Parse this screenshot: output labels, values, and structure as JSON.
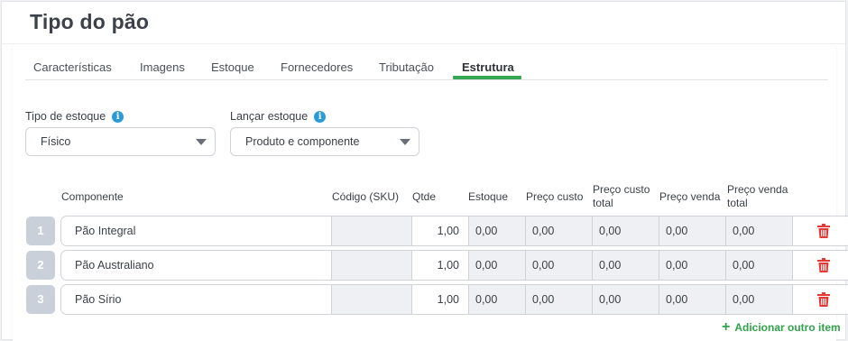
{
  "page": {
    "title": "Tipo do pão"
  },
  "tabs": [
    {
      "label": "Características"
    },
    {
      "label": "Imagens"
    },
    {
      "label": "Estoque"
    },
    {
      "label": "Fornecedores"
    },
    {
      "label": "Tributação"
    },
    {
      "label": "Estrutura",
      "active": true
    }
  ],
  "form": {
    "tipo_estoque": {
      "label": "Tipo de estoque",
      "value": "Físico"
    },
    "lancar_estoque": {
      "label": "Lançar estoque",
      "value": "Produto e componente"
    }
  },
  "table": {
    "headers": {
      "componente": "Componente",
      "sku": "Código (SKU)",
      "qtde": "Qtde",
      "estoque": "Estoque",
      "preco_custo": "Preço custo",
      "preco_custo_total": "Preço custo total",
      "preco_venda": "Preço venda",
      "preco_venda_total": "Preço venda total"
    },
    "rows": [
      {
        "num": "1",
        "componente": "Pão Integral",
        "sku": "",
        "qtde": "1,00",
        "estoque": "0,00",
        "preco_custo": "0,00",
        "preco_custo_total": "0,00",
        "preco_venda": "0,00",
        "preco_venda_total": "0,00"
      },
      {
        "num": "2",
        "componente": "Pão Australiano",
        "sku": "",
        "qtde": "1,00",
        "estoque": "0,00",
        "preco_custo": "0,00",
        "preco_custo_total": "0,00",
        "preco_venda": "0,00",
        "preco_venda_total": "0,00"
      },
      {
        "num": "3",
        "componente": "Pão Sírio",
        "sku": "",
        "qtde": "1,00",
        "estoque": "0,00",
        "preco_custo": "0,00",
        "preco_custo_total": "0,00",
        "preco_venda": "0,00",
        "preco_venda_total": "0,00"
      }
    ]
  },
  "actions": {
    "add_item": "Adicionar outro item"
  },
  "icons": {
    "info": "info-icon",
    "trash": "trash-icon",
    "caret": "chevron-down-icon",
    "plus": "plus-icon"
  },
  "colors": {
    "accent": "#34a853",
    "delete": "#e53935",
    "info": "#2a9bd7"
  }
}
